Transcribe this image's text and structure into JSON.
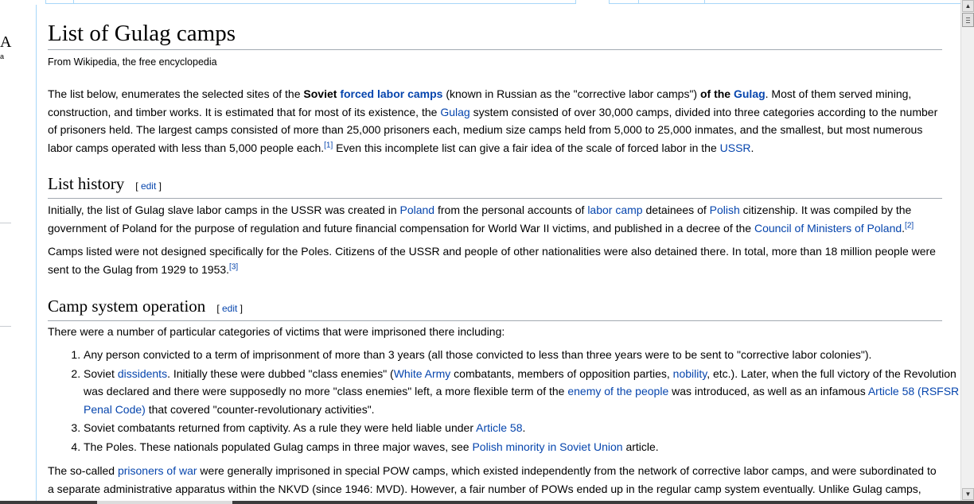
{
  "page": {
    "title": "List of Gulag camps",
    "tagline": "From Wikipedia, the free encyclopedia"
  },
  "sidebar": {
    "logo_fragment": "A",
    "logo_sub": "a"
  },
  "intro": {
    "t1": "The list below, enumerates the selected sites of the ",
    "b1": "Soviet",
    "l1": "forced labor camps",
    "t2": " (known in Russian as the \"corrective labor camps\") ",
    "b2": "of the",
    "l2": "Gulag",
    "t3": ". Most of them served mining, construction, and timber works. It is estimated that for most of its existence, the ",
    "l3": "Gulag",
    "t4": " system consisted of over 30,000 camps, divided into three categories according to the number of prisoners held. The largest camps consisted of more than 25,000 prisoners each, medium size camps held from 5,000 to 25,000 inmates, and the smallest, but most numerous labor camps operated with less than 5,000 people each.",
    "ref1": "[1]",
    "t5": " Even this incomplete list can give a fair idea of the scale of forced labor in the ",
    "l4": "USSR",
    "t6": "."
  },
  "history": {
    "heading": "List history",
    "edit": "[ edit ]",
    "p1": {
      "t1": "Initially, the list of Gulag slave labor camps in the USSR was created in ",
      "l1": "Poland",
      "t2": " from the personal accounts of ",
      "l2": "labor camp",
      "t3": " detainees of ",
      "l3": "Polish",
      "t4": " citizenship. It was compiled by the government of Poland for the purpose of regulation and future financial compensation for World War II victims, and published in a decree of the ",
      "l4": "Council of Ministers of Poland",
      "t5": ".",
      "ref": "[2]"
    },
    "p2": {
      "t1": "Camps listed were not designed specifically for the Poles. Citizens of the USSR and people of other nationalities were also detained there. In total, more than 18 million people were sent to the Gulag from 1929 to 1953.",
      "ref": "[3]"
    }
  },
  "camp": {
    "heading": "Camp system operation",
    "edit": "[ edit ]",
    "intro": "There were a number of particular categories of victims that were imprisoned there including:",
    "items": [
      {
        "t1": "Any person convicted to a term of imprisonment of more than 3 years (all those convicted to less than three years were to be sent to \"corrective labor colonies\")."
      },
      {
        "t1": "Soviet ",
        "l1": "dissidents",
        "t2": ". Initially these were dubbed \"class enemies\" (",
        "l2": "White Army",
        "t3": " combatants, members of opposition parties, ",
        "l3": "nobility",
        "t4": ", etc.). Later, when the full victory of the Revolution was declared and there were supposedly no more \"class enemies\" left, a more flexible term of the ",
        "l4": "enemy of the people",
        "t5": " was introduced, as well as an infamous ",
        "l5": "Article 58 (RSFSR Penal Code)",
        "t6": " that covered \"counter-revolutionary activities\"."
      },
      {
        "t1": "Soviet combatants returned from captivity. As a rule they were held liable under ",
        "l1": "Article 58",
        "t2": "."
      },
      {
        "t1": "The Poles. These nationals populated Gulag camps in three major waves, see ",
        "l1": "Polish minority in Soviet Union",
        "t2": " article."
      }
    ],
    "pow": {
      "t1": "The so-called ",
      "l1": "prisoners of war",
      "t2": " were generally imprisoned in special POW camps, which existed independently from the network of corrective labor camps, and were subordinated to a separate administrative apparatus within the NKVD (since 1946: MVD). However, a fair number of POWs ended up in the regular camp system eventually. Unlike Gulag camps,"
    }
  },
  "scrollbar": {
    "up_icon": "▲",
    "down_icon": "▼"
  },
  "colors": {
    "link": "#0645ad",
    "border": "#a7d7f9",
    "rule": "#a2a9b1"
  }
}
